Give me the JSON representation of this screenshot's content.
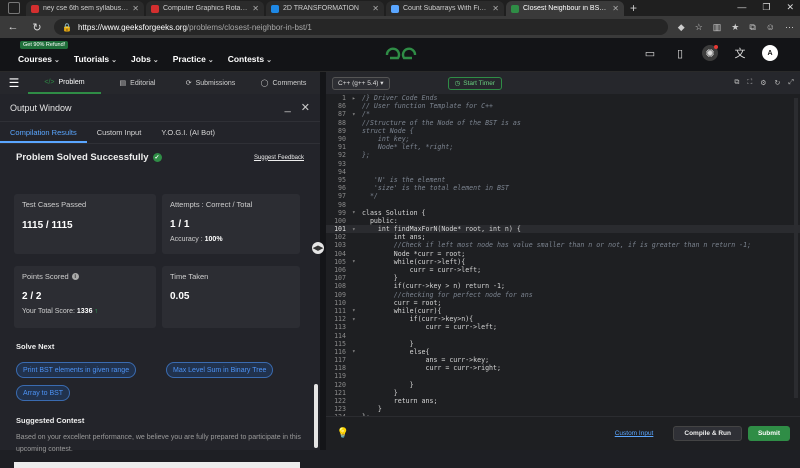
{
  "browser": {
    "tabs": [
      {
        "title": "ney cse 6th sem syllabus .pdf",
        "color": "#d32f2f"
      },
      {
        "title": "Computer Graphics Rotation - ja...",
        "color": "#d32f2f"
      },
      {
        "title": "2D TRANSFORMATION",
        "color": "#1e88e5"
      },
      {
        "title": "Count Subarrays With Fixed Bou...",
        "color": "#5aa6ff"
      },
      {
        "title": "Closest Neighbour in BST | Practi...",
        "color": "#2f8d46"
      }
    ],
    "url_host": "https://www.geeksforgeeks.org",
    "url_path": "/problems/closest-neighbor-in-bst/1"
  },
  "header": {
    "refund_badge": "Get 90% Refund!",
    "menu": [
      "Courses",
      "Tutorials",
      "Jobs",
      "Practice",
      "Contests"
    ],
    "avatar_letter": "A"
  },
  "problem_nav": {
    "tabs": [
      "Problem",
      "Editorial",
      "Submissions",
      "Comments"
    ]
  },
  "output": {
    "title": "Output Window",
    "tabs": [
      "Compilation Results",
      "Custom Input",
      "Y.O.G.I. (AI Bot)"
    ],
    "status": "Problem Solved Successfully",
    "suggest_feedback": "Suggest Feedback",
    "test_cases_label": "Test Cases Passed",
    "test_cases_value": "1115 / 1115",
    "attempts_label": "Attempts : Correct / Total",
    "attempts_value": "1 / 1",
    "accuracy_label": "Accuracy :",
    "accuracy_value": "100%",
    "points_label": "Points Scored",
    "points_value": "2 / 2",
    "total_score_label": "Your Total Score:",
    "total_score_value": "1336",
    "time_label": "Time Taken",
    "time_value": "0.05",
    "solve_next_title": "Solve Next",
    "solve_next": [
      "Print BST elements in given range",
      "Max Level Sum in Binary Tree",
      "Array to BST"
    ],
    "suggested_contest_title": "Suggested Contest",
    "suggested_contest_desc": "Based on your excellent performance, we believe you are fully prepared to participate in this upcoming contest."
  },
  "editor": {
    "language": "C++ (g++ 5.4)",
    "timer": "Start Timer",
    "custom_input": "Custom Input",
    "compile_run": "Compile & Run",
    "submit": "Submit",
    "lines": [
      {
        "n": "1",
        "t": "/} Driver Code Ends",
        "k": "cm",
        "fold": "▸"
      },
      {
        "n": "86",
        "t": "// User function Template for C++",
        "k": "cm"
      },
      {
        "n": "87",
        "t": "/*",
        "k": "cm",
        "fold": "▾"
      },
      {
        "n": "88",
        "t": "//Structure of the Node of the BST is as",
        "k": "cm"
      },
      {
        "n": "89",
        "t": "struct Node {",
        "k": "cm"
      },
      {
        "n": "90",
        "t": "    int key;",
        "k": "cm"
      },
      {
        "n": "91",
        "t": "    Node* left, *right;",
        "k": "cm"
      },
      {
        "n": "92",
        "t": "};",
        "k": "cm"
      },
      {
        "n": "93",
        "t": "",
        "k": "cm"
      },
      {
        "n": "94",
        "t": "",
        "k": "cm"
      },
      {
        "n": "95",
        "t": "   'N' is the element",
        "k": "cm"
      },
      {
        "n": "96",
        "t": "   'size' is the total element in BST",
        "k": "cm"
      },
      {
        "n": "97",
        "t": "  */",
        "k": "cm"
      },
      {
        "n": "98",
        "t": "",
        "k": "kw"
      },
      {
        "n": "99",
        "t": "class Solution {",
        "k": "kw",
        "fold": "▾"
      },
      {
        "n": "100",
        "t": "  public:",
        "k": "kw"
      },
      {
        "n": "101",
        "t": "    int findMaxForN(Node* root, int n) {",
        "k": "kw",
        "fold": "▾",
        "cur": true
      },
      {
        "n": "102",
        "t": "        int ans;",
        "k": "kw"
      },
      {
        "n": "103",
        "t": "        //Check if left most node has value smaller than n or not, if is greater than n return -1;",
        "k": "cm"
      },
      {
        "n": "104",
        "t": "        Node *curr = root;",
        "k": "kw"
      },
      {
        "n": "105",
        "t": "        while(curr->left){",
        "k": "kw",
        "fold": "▾"
      },
      {
        "n": "106",
        "t": "            curr = curr->left;",
        "k": "kw"
      },
      {
        "n": "107",
        "t": "        }",
        "k": "kw"
      },
      {
        "n": "108",
        "t": "        if(curr->key > n) return -1;",
        "k": "kw"
      },
      {
        "n": "109",
        "t": "        //checking for perfect node for ans",
        "k": "cm"
      },
      {
        "n": "110",
        "t": "        curr = root;",
        "k": "kw"
      },
      {
        "n": "111",
        "t": "        while(curr){",
        "k": "kw",
        "fold": "▾"
      },
      {
        "n": "112",
        "t": "            if(curr->key>n){",
        "k": "kw",
        "fold": "▾"
      },
      {
        "n": "113",
        "t": "                curr = curr->left;",
        "k": "kw"
      },
      {
        "n": "114",
        "t": "",
        "k": "kw"
      },
      {
        "n": "115",
        "t": "            }",
        "k": "kw"
      },
      {
        "n": "116",
        "t": "            else{",
        "k": "kw",
        "fold": "▾"
      },
      {
        "n": "117",
        "t": "                ans = curr->key;",
        "k": "kw"
      },
      {
        "n": "118",
        "t": "                curr = curr->right;",
        "k": "kw"
      },
      {
        "n": "119",
        "t": "",
        "k": "kw"
      },
      {
        "n": "120",
        "t": "            }",
        "k": "kw"
      },
      {
        "n": "121",
        "t": "        }",
        "k": "kw"
      },
      {
        "n": "122",
        "t": "        return ans;",
        "k": "kw"
      },
      {
        "n": "123",
        "t": "    }",
        "k": "kw"
      },
      {
        "n": "124",
        "t": "};",
        "k": "kw"
      },
      {
        "n": "125",
        "t": "/} Driver Code Ends",
        "k": "cm",
        "fold": "▸"
      }
    ]
  }
}
